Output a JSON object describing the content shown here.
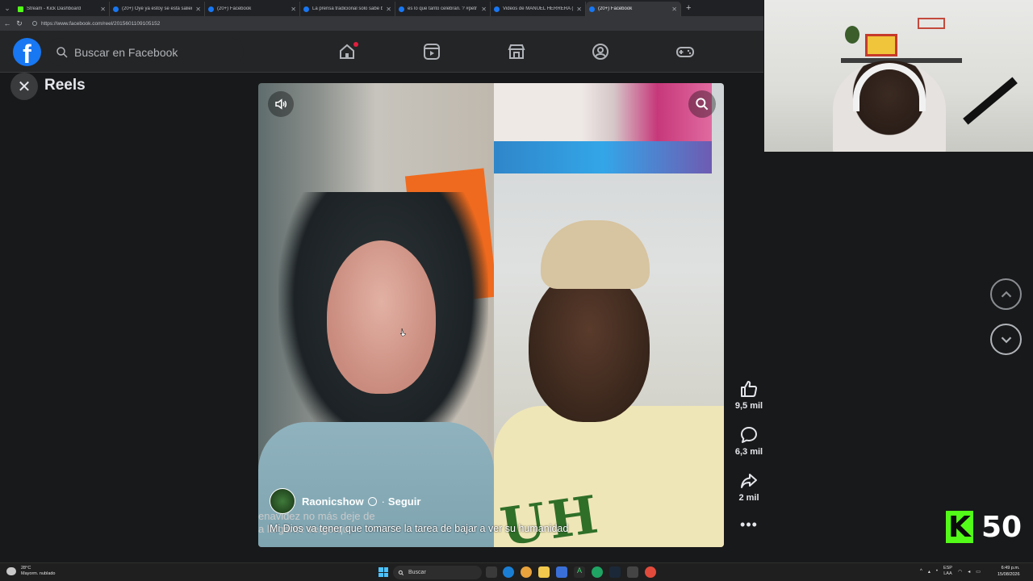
{
  "browser": {
    "tabs": [
      {
        "title": "Stream - Kick Dashboard",
        "favicon": "kick-icon",
        "active": false
      },
      {
        "title": "(20+) Oye ya estoy se está saliend",
        "favicon": "facebook-icon",
        "active": false
      },
      {
        "title": "(20+) Facebook",
        "favicon": "facebook-icon",
        "active": false
      },
      {
        "title": "La prensa tradicional solo sabe b",
        "favicon": "facebook-icon",
        "active": false
      },
      {
        "title": "es lo que tanto celebran. ? #petr",
        "favicon": "facebook-icon",
        "active": false
      },
      {
        "title": "Videos de MANUEL HERRERA (@r",
        "favicon": "facebook-icon",
        "active": false
      },
      {
        "title": "(20+) Facebook",
        "favicon": "facebook-icon",
        "active": true
      }
    ],
    "new_tab": "+",
    "url": "https://www.facebook.com/reel/2015601109105152"
  },
  "facebook": {
    "logo": "f",
    "search_placeholder": "Buscar en Facebook",
    "nav": [
      "home-icon",
      "video-icon",
      "marketplace-icon",
      "groups-icon",
      "gaming-icon"
    ],
    "accent": "#1877f2"
  },
  "reels": {
    "title": "Reels",
    "author": "Raonicshow",
    "follow": "Seguir",
    "caption": "Mi Dios va tener que tomarse la tarea de bajar a ver su humanidad",
    "ghost_caption_line1": "enavidez no más deje de",
    "ghost_caption_line2": "a la gente vergerqu",
    "likes": "9,5 mil",
    "comments": "6,3 mil",
    "shares": "2 mil",
    "more": "•••"
  },
  "stream": {
    "kick_logo": "K",
    "viewer_count": "50",
    "kick_color": "#53fc18"
  },
  "taskbar": {
    "temperature": "28°C",
    "weather": "Mayorm. nublado",
    "search": "Buscar",
    "lang_line1": "ESP",
    "lang_line2": "LAA",
    "time": "6:49 p.m.",
    "date": "15/08/2026"
  }
}
